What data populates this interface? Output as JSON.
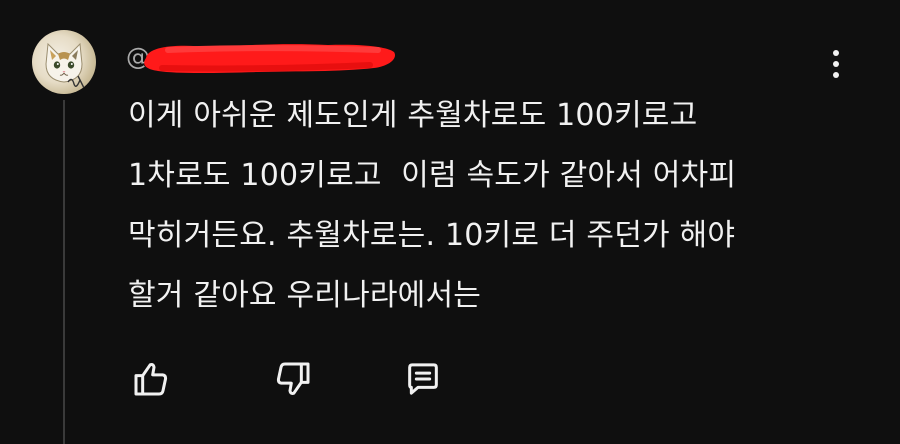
{
  "comment": {
    "author_prefix": "@",
    "author_redacted": true,
    "lines": [
      "이게 아쉬운 제도인게 추월차로도 100키로고",
      "1차로도 100키로고  이럼 속도가 같아서 어차피",
      "막히거든요. 추월차로는. 10키로 더 주던가 해야",
      "할거 같아요 우리나라에서는"
    ]
  },
  "icons": {
    "menu": "more-vert-icon",
    "like": "thumb-up-icon",
    "dislike": "thumb-down-icon",
    "reply": "comment-icon"
  },
  "colors": {
    "background": "#0f0f0f",
    "text": "#f1f1f1",
    "redaction": "#ff1a1a",
    "thread_line": "#3a3a3a"
  }
}
